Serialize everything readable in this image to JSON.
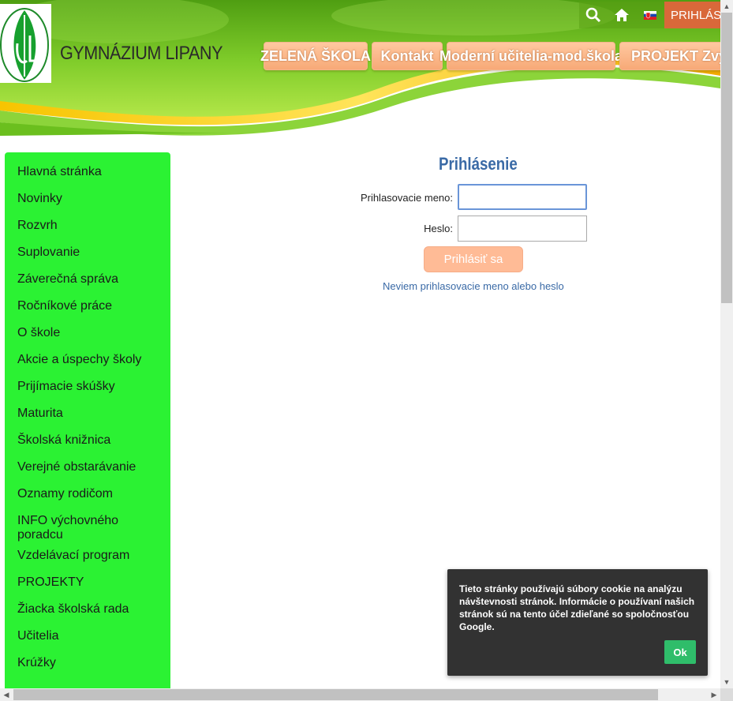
{
  "header": {
    "site_title": "GYMNÁZIUM LIPANY",
    "logo_icon": "school-leaf-logo-icon",
    "top_icons": [
      "search-icon",
      "home-icon",
      "slovak-flag-icon"
    ],
    "login_top": "PRIHLÁS",
    "nav_tabs": [
      "ZELENÁ ŠKOLA",
      "Kontakt",
      "Moderní učitelia-mod.škola",
      "PROJEKT Zvýšeni"
    ]
  },
  "sidebar": {
    "items": [
      "Hlavná stránka",
      "Novinky",
      "Rozvrh",
      "Suplovanie",
      "Záverečná správa",
      "Ročníkové práce",
      "O škole",
      "Akcie a úspechy školy",
      "Prijímacie skúšky",
      "Maturita",
      "Školská knižnica",
      "Verejné obstarávanie",
      "Oznamy rodičom",
      "INFO výchovného poradcu",
      "Vzdelávací program",
      "PROJEKTY",
      "Žiacka školská rada",
      "Učitelia",
      "Krúžky"
    ]
  },
  "login": {
    "title": "Prihlásenie",
    "username_label": "Prihlasovacie meno:",
    "username_value": "",
    "password_label": "Heslo:",
    "password_value": "",
    "submit": "Prihlásiť sa",
    "forgot": "Neviem prihlasovacie meno alebo heslo"
  },
  "cookie": {
    "text": "Tieto stránky používajú súbory cookie na analýzu návštevnosti stránok. Informácie o používaní našich stránok sú na tento účel zdieľané so spoločnosťou Google.",
    "ok": "Ok"
  },
  "colors": {
    "sidebar_bg": "#2bf233",
    "header_green": "#6bbf1e",
    "accent_orange": "#f7a977",
    "link_blue": "#3a6aa6"
  }
}
